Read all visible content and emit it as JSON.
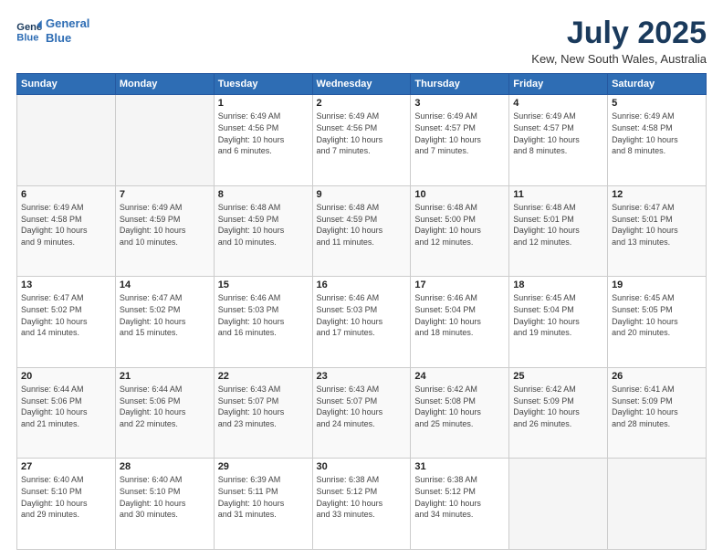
{
  "logo": {
    "line1": "General",
    "line2": "Blue"
  },
  "title": "July 2025",
  "subtitle": "Kew, New South Wales, Australia",
  "days_header": [
    "Sunday",
    "Monday",
    "Tuesday",
    "Wednesday",
    "Thursday",
    "Friday",
    "Saturday"
  ],
  "weeks": [
    [
      {
        "day": "",
        "info": ""
      },
      {
        "day": "",
        "info": ""
      },
      {
        "day": "1",
        "info": "Sunrise: 6:49 AM\nSunset: 4:56 PM\nDaylight: 10 hours\nand 6 minutes."
      },
      {
        "day": "2",
        "info": "Sunrise: 6:49 AM\nSunset: 4:56 PM\nDaylight: 10 hours\nand 7 minutes."
      },
      {
        "day": "3",
        "info": "Sunrise: 6:49 AM\nSunset: 4:57 PM\nDaylight: 10 hours\nand 7 minutes."
      },
      {
        "day": "4",
        "info": "Sunrise: 6:49 AM\nSunset: 4:57 PM\nDaylight: 10 hours\nand 8 minutes."
      },
      {
        "day": "5",
        "info": "Sunrise: 6:49 AM\nSunset: 4:58 PM\nDaylight: 10 hours\nand 8 minutes."
      }
    ],
    [
      {
        "day": "6",
        "info": "Sunrise: 6:49 AM\nSunset: 4:58 PM\nDaylight: 10 hours\nand 9 minutes."
      },
      {
        "day": "7",
        "info": "Sunrise: 6:49 AM\nSunset: 4:59 PM\nDaylight: 10 hours\nand 10 minutes."
      },
      {
        "day": "8",
        "info": "Sunrise: 6:48 AM\nSunset: 4:59 PM\nDaylight: 10 hours\nand 10 minutes."
      },
      {
        "day": "9",
        "info": "Sunrise: 6:48 AM\nSunset: 4:59 PM\nDaylight: 10 hours\nand 11 minutes."
      },
      {
        "day": "10",
        "info": "Sunrise: 6:48 AM\nSunset: 5:00 PM\nDaylight: 10 hours\nand 12 minutes."
      },
      {
        "day": "11",
        "info": "Sunrise: 6:48 AM\nSunset: 5:01 PM\nDaylight: 10 hours\nand 12 minutes."
      },
      {
        "day": "12",
        "info": "Sunrise: 6:47 AM\nSunset: 5:01 PM\nDaylight: 10 hours\nand 13 minutes."
      }
    ],
    [
      {
        "day": "13",
        "info": "Sunrise: 6:47 AM\nSunset: 5:02 PM\nDaylight: 10 hours\nand 14 minutes."
      },
      {
        "day": "14",
        "info": "Sunrise: 6:47 AM\nSunset: 5:02 PM\nDaylight: 10 hours\nand 15 minutes."
      },
      {
        "day": "15",
        "info": "Sunrise: 6:46 AM\nSunset: 5:03 PM\nDaylight: 10 hours\nand 16 minutes."
      },
      {
        "day": "16",
        "info": "Sunrise: 6:46 AM\nSunset: 5:03 PM\nDaylight: 10 hours\nand 17 minutes."
      },
      {
        "day": "17",
        "info": "Sunrise: 6:46 AM\nSunset: 5:04 PM\nDaylight: 10 hours\nand 18 minutes."
      },
      {
        "day": "18",
        "info": "Sunrise: 6:45 AM\nSunset: 5:04 PM\nDaylight: 10 hours\nand 19 minutes."
      },
      {
        "day": "19",
        "info": "Sunrise: 6:45 AM\nSunset: 5:05 PM\nDaylight: 10 hours\nand 20 minutes."
      }
    ],
    [
      {
        "day": "20",
        "info": "Sunrise: 6:44 AM\nSunset: 5:06 PM\nDaylight: 10 hours\nand 21 minutes."
      },
      {
        "day": "21",
        "info": "Sunrise: 6:44 AM\nSunset: 5:06 PM\nDaylight: 10 hours\nand 22 minutes."
      },
      {
        "day": "22",
        "info": "Sunrise: 6:43 AM\nSunset: 5:07 PM\nDaylight: 10 hours\nand 23 minutes."
      },
      {
        "day": "23",
        "info": "Sunrise: 6:43 AM\nSunset: 5:07 PM\nDaylight: 10 hours\nand 24 minutes."
      },
      {
        "day": "24",
        "info": "Sunrise: 6:42 AM\nSunset: 5:08 PM\nDaylight: 10 hours\nand 25 minutes."
      },
      {
        "day": "25",
        "info": "Sunrise: 6:42 AM\nSunset: 5:09 PM\nDaylight: 10 hours\nand 26 minutes."
      },
      {
        "day": "26",
        "info": "Sunrise: 6:41 AM\nSunset: 5:09 PM\nDaylight: 10 hours\nand 28 minutes."
      }
    ],
    [
      {
        "day": "27",
        "info": "Sunrise: 6:40 AM\nSunset: 5:10 PM\nDaylight: 10 hours\nand 29 minutes."
      },
      {
        "day": "28",
        "info": "Sunrise: 6:40 AM\nSunset: 5:10 PM\nDaylight: 10 hours\nand 30 minutes."
      },
      {
        "day": "29",
        "info": "Sunrise: 6:39 AM\nSunset: 5:11 PM\nDaylight: 10 hours\nand 31 minutes."
      },
      {
        "day": "30",
        "info": "Sunrise: 6:38 AM\nSunset: 5:12 PM\nDaylight: 10 hours\nand 33 minutes."
      },
      {
        "day": "31",
        "info": "Sunrise: 6:38 AM\nSunset: 5:12 PM\nDaylight: 10 hours\nand 34 minutes."
      },
      {
        "day": "",
        "info": ""
      },
      {
        "day": "",
        "info": ""
      }
    ]
  ]
}
